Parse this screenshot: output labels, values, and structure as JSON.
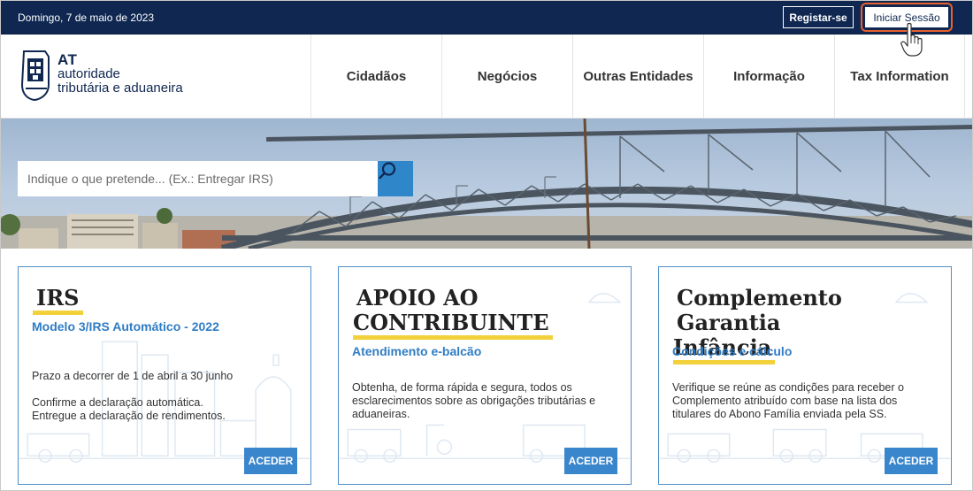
{
  "topbar": {
    "date": "Domingo, 7 de maio de 2023",
    "register_label": "Registar-se",
    "login_label": "Iniciar Sessão"
  },
  "logo": {
    "line1": "AT",
    "line2": "autoridade",
    "line3": "tributária e aduaneira"
  },
  "nav": {
    "items": [
      {
        "label": "Cidadãos"
      },
      {
        "label": "Negócios"
      },
      {
        "label": "Outras Entidades"
      },
      {
        "label": "Informação"
      },
      {
        "label": "Tax Information"
      }
    ]
  },
  "search": {
    "placeholder": "Indique o que pretende... (Ex.: Entregar IRS)",
    "icon": "search-icon"
  },
  "cards": [
    {
      "title_line1": "IRS",
      "title_line2": "",
      "subtitle": "Modelo 3/IRS Automático - 2022",
      "text1": "Prazo a decorrer de 1 de abril a 30 junho",
      "text2": "Confirme a declaração automática. Entregue a declaração de rendimentos.",
      "button": "ACEDER"
    },
    {
      "title_line1": "APOIO AO",
      "title_line2": "CONTRIBUINTE",
      "subtitle": "Atendimento e-balcão",
      "text1": "Obtenha, de forma rápida e segura, todos os esclarecimentos sobre as obrigações tributárias e aduaneiras.",
      "button": "ACEDER"
    },
    {
      "title_line1": "Complemento Garantia",
      "title_line2": "Infância",
      "subtitle": "Condições e cálculo",
      "text1": "Verifique se reúne as condições para receber o Complemento atribuído com base na lista dos titulares do Abono Família enviada pela SS.",
      "button": "ACEDER"
    }
  ],
  "colors": {
    "topbar": "#0f2751",
    "accent_blue": "#3a86cc",
    "highlight_yellow": "#f2d13a",
    "login_outline": "#e8602c"
  }
}
